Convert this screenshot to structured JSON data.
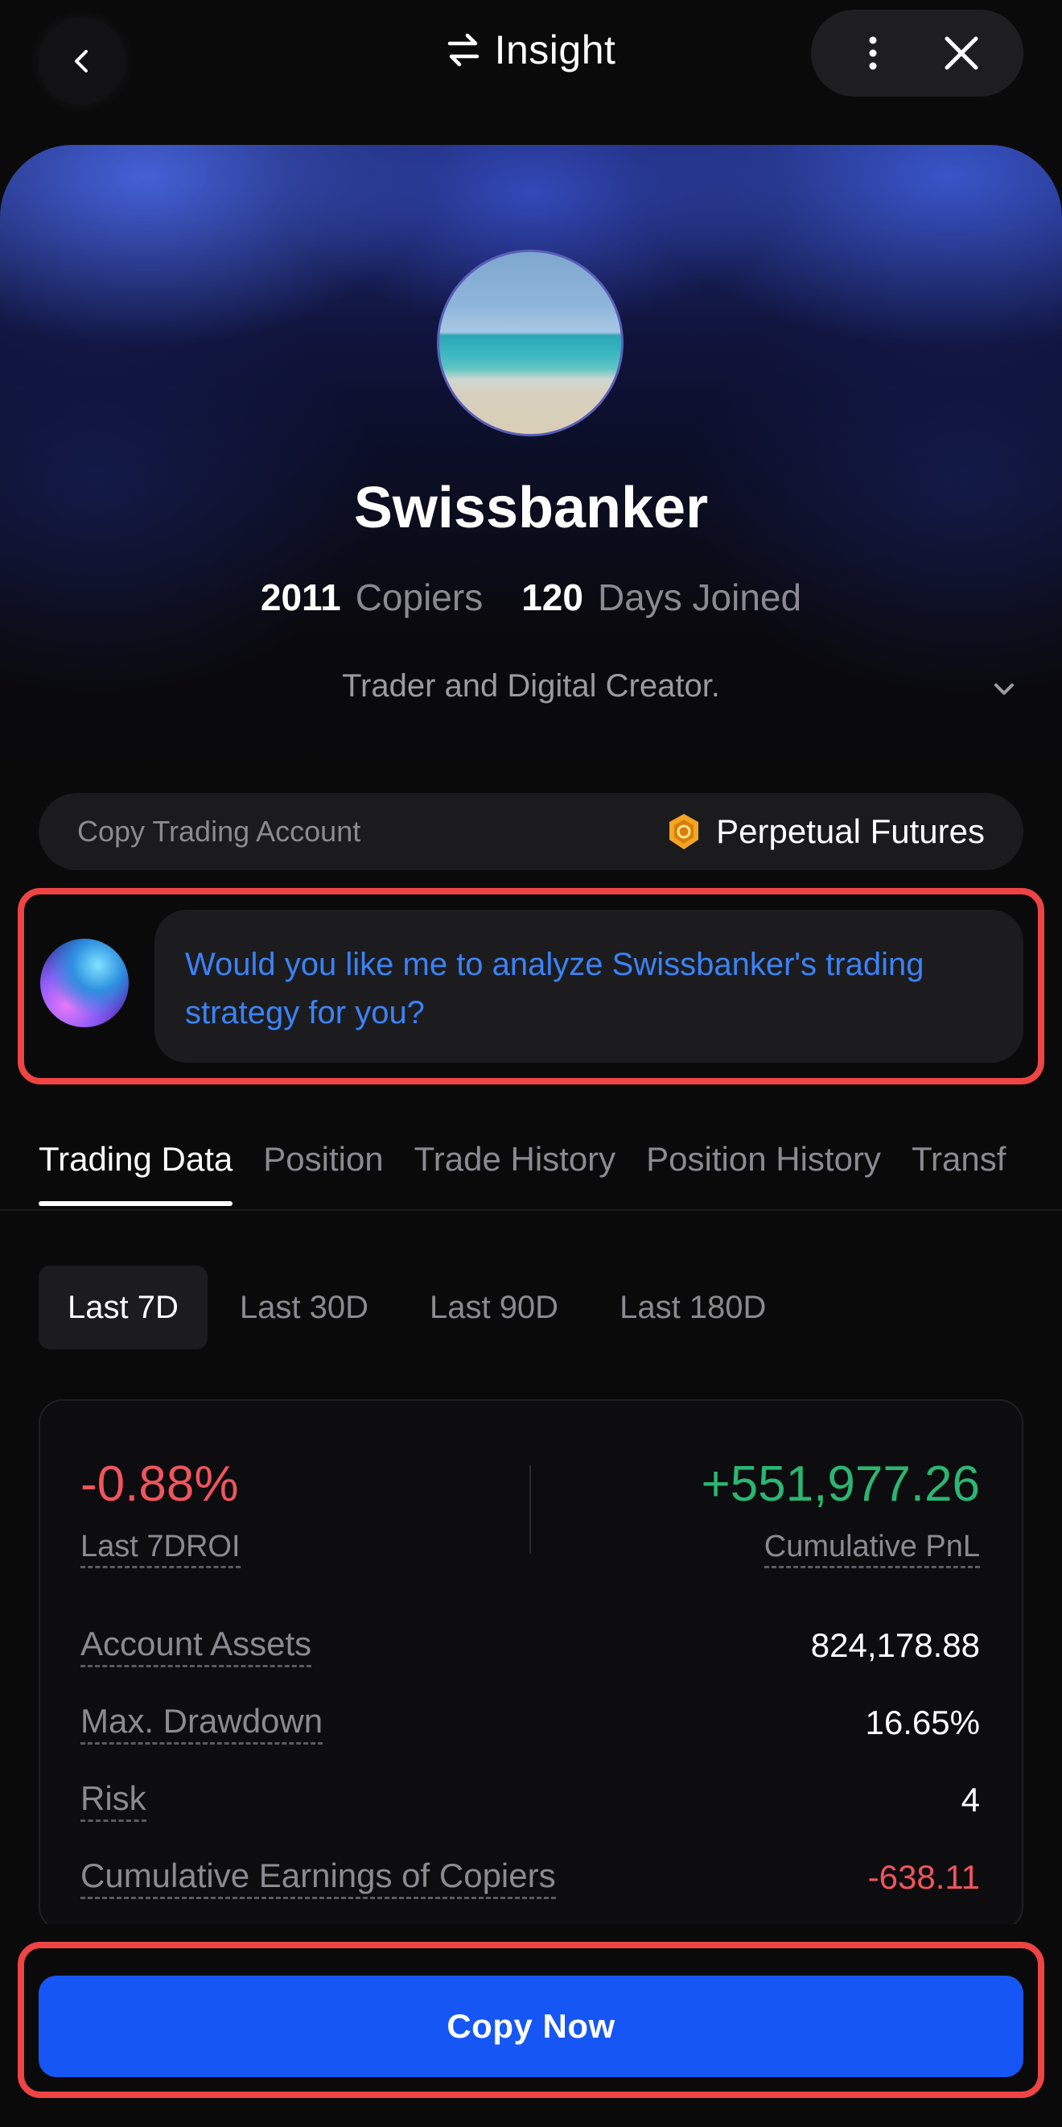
{
  "header": {
    "title": "Insight",
    "back_icon": "chevron-left-icon",
    "switch_icon": "swap-arrows-icon",
    "more_icon": "more-vertical-icon",
    "close_icon": "close-icon"
  },
  "profile": {
    "name": "Swissbanker",
    "copiers_count": "2011",
    "copiers_label": "Copiers",
    "days_count": "120",
    "days_label": "Days Joined",
    "bio": "Trader and Digital Creator."
  },
  "account": {
    "label": "Copy Trading Account",
    "type": "Perpetual Futures",
    "type_icon": "futures-badge-icon"
  },
  "assistant": {
    "message": "Would you like me to analyze Swissbanker's trading strategy for you?"
  },
  "tabs": [
    {
      "label": "Trading Data",
      "active": true
    },
    {
      "label": "Position",
      "active": false
    },
    {
      "label": "Trade History",
      "active": false
    },
    {
      "label": "Position History",
      "active": false
    },
    {
      "label": "Transf",
      "active": false
    }
  ],
  "periods": [
    {
      "label": "Last 7D",
      "active": true
    },
    {
      "label": "Last 30D",
      "active": false
    },
    {
      "label": "Last 90D",
      "active": false
    },
    {
      "label": "Last 180D",
      "active": false
    }
  ],
  "summary": {
    "roi_value": "-0.88%",
    "roi_label": "Last 7DROI",
    "pnl_value": "+551,977.26",
    "pnl_label": "Cumulative PnL"
  },
  "metrics": [
    {
      "label": "Account Assets",
      "value": "824,178.88"
    },
    {
      "label": "Max. Drawdown",
      "value": "16.65%"
    },
    {
      "label": "Risk",
      "value": "4"
    },
    {
      "label": "Cumulative Earnings of Copiers",
      "value": "-638.11"
    }
  ],
  "cta": {
    "label": "Copy Now"
  },
  "colors": {
    "accent": "#1556f5",
    "negative": "#f0555d",
    "positive": "#2bb673",
    "highlight": "#ef4444",
    "assistant_text": "#3b82f6"
  }
}
